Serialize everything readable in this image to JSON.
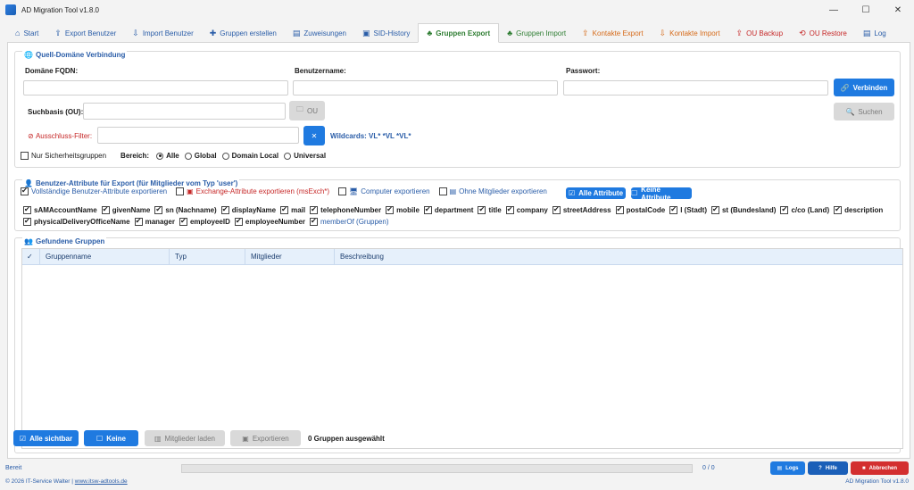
{
  "window": {
    "title": "AD Migration Tool v1.8.0",
    "minimize": "—",
    "maximize": "☐",
    "close": "✕"
  },
  "tabs": [
    {
      "label": "Start",
      "icon": "home-icon",
      "glyph": "⌂"
    },
    {
      "label": "Export Benutzer",
      "icon": "export-icon",
      "glyph": "⇪"
    },
    {
      "label": "Import Benutzer",
      "icon": "import-icon",
      "glyph": "⇩"
    },
    {
      "label": "Gruppen erstellen",
      "icon": "plus-icon",
      "glyph": "✚"
    },
    {
      "label": "Zuweisungen",
      "icon": "assign-icon",
      "glyph": "▤"
    },
    {
      "label": "SID-History",
      "icon": "sid-icon",
      "glyph": "▣"
    },
    {
      "label": "Gruppen Export",
      "icon": "group-export-icon",
      "glyph": "♣"
    },
    {
      "label": "Gruppen Import",
      "icon": "group-import-icon",
      "glyph": "♣"
    },
    {
      "label": "Kontakte Export",
      "icon": "contact-export-icon",
      "glyph": "⇪"
    },
    {
      "label": "Kontakte Import",
      "icon": "contact-import-icon",
      "glyph": "⇩"
    },
    {
      "label": "OU Backup",
      "icon": "backup-icon",
      "glyph": "⇪"
    },
    {
      "label": "OU Restore",
      "icon": "restore-icon",
      "glyph": "⟲"
    },
    {
      "label": "Log",
      "icon": "log-icon",
      "glyph": "▤"
    }
  ],
  "source": {
    "title": "Quell-Domäne Verbindung",
    "fqdn_label": "Domäne FQDN:",
    "fqdn_value": "",
    "user_label": "Benutzername:",
    "user_value": "",
    "password_label": "Passwort:",
    "password_value": "",
    "connect_button": "Verbinden",
    "searchbase_label": "Suchbasis (OU):",
    "searchbase_value": "",
    "ou_button": "OU",
    "search_button": "Suchen",
    "exclude_label": "Ausschluss-Filter:",
    "exclude_value": "",
    "clear_button": "✕",
    "wildcards": "Wildcards: VL* *VL *VL*",
    "only_security": "Nur Sicherheitsgruppen",
    "scope_label": "Bereich:",
    "scopes": [
      "Alle",
      "Global",
      "Domain Local",
      "Universal"
    ]
  },
  "attributes": {
    "title": "Benutzer-Attribute für Export (für Mitglieder vom Typ 'user')",
    "full_export": "Vollständige Benutzer-Attribute exportieren",
    "exchange_export": "Exchange-Attribute exportieren (msExch*)",
    "computer_export": "Computer exportieren",
    "without_members": "Ohne Mitglieder exportieren",
    "all_button": "Alle Attribute",
    "none_button": "Keine Attribute",
    "row1": [
      "sAMAccountName",
      "givenName",
      "sn (Nachname)",
      "displayName",
      "mail",
      "telephoneNumber",
      "mobile",
      "department",
      "title",
      "company",
      "streetAddress",
      "postalCode",
      "l (Stadt)",
      "st (Bundesland)",
      "c/co (Land)",
      "description"
    ],
    "row2": [
      "physicalDeliveryOfficeName",
      "manager",
      "employeeID",
      "employeeNumber",
      "memberOf (Gruppen)"
    ]
  },
  "groups": {
    "title": "Gefundene Gruppen",
    "columns": [
      "✓",
      "Gruppenname",
      "Typ",
      "Mitglieder",
      "Beschreibung"
    ],
    "rows": []
  },
  "bottom": {
    "all_visible": "Alle sichtbar",
    "none": "Keine",
    "load_members": "Mitglieder laden",
    "export": "Exportieren",
    "selected": "0 Gruppen ausgewählt"
  },
  "status": {
    "ready": "Bereit",
    "progress": 0,
    "count": "0 / 0",
    "logs_button": "Logs",
    "help_button": "Hilfe",
    "cancel_button": "Abbrechen",
    "copyright_prefix": "© 2026 IT-Service Walter | ",
    "copyright_link": "www.itsw-adtools.de",
    "version": "AD Migration Tool v1.8.0"
  },
  "colors": {
    "accent": "#1f7ae0",
    "active_tab": "#2e7d32",
    "danger": "#d32f2f",
    "orange": "#d66b1a"
  }
}
